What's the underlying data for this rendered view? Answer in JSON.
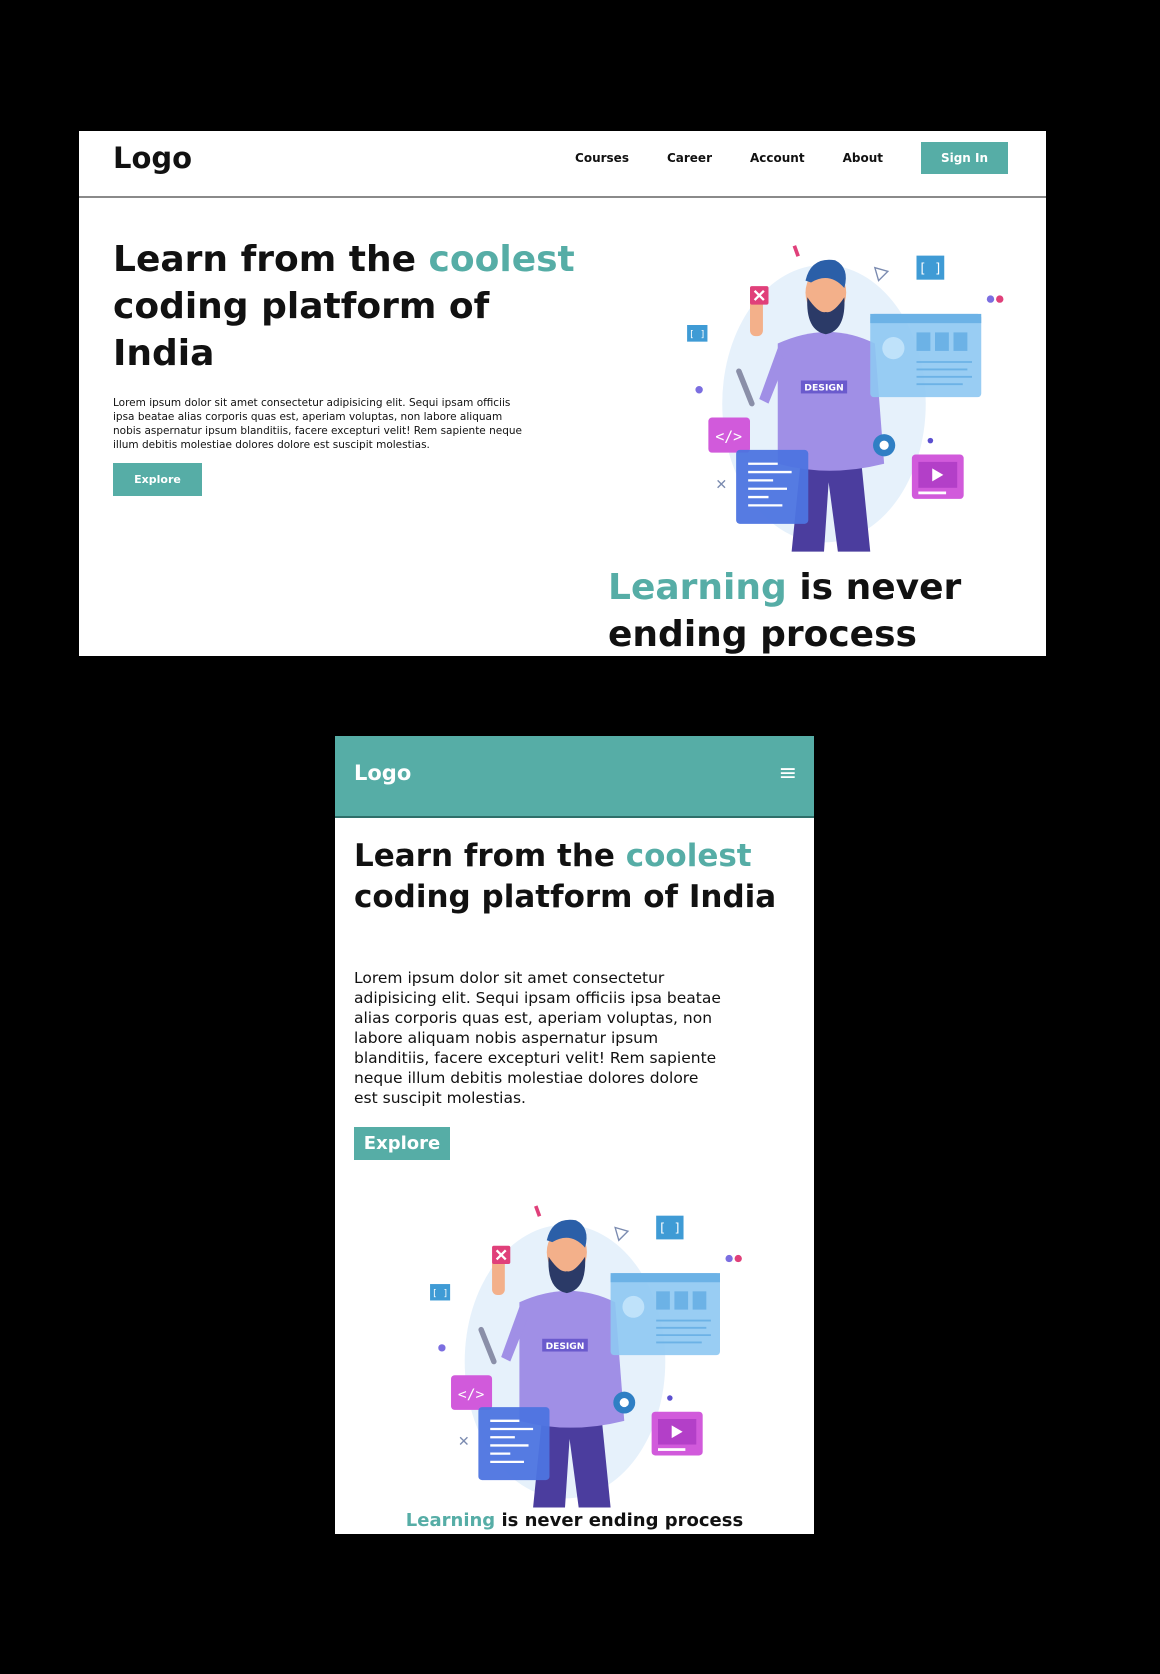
{
  "brand": {
    "teal": "#56ada6",
    "dark": "#111111"
  },
  "desktop": {
    "logo": "Logo",
    "nav": [
      "Courses",
      "Career",
      "Account",
      "About"
    ],
    "signin": "Sign In",
    "headline": {
      "pre": "Learn from the ",
      "accent": "coolest",
      "post": " coding platform of India"
    },
    "paragraph": "Lorem ipsum dolor sit amet consectetur adipisicing elit. Sequi ipsam officiis ipsa beatae alias corporis quas est, aperiam voluptas, non labore aliquam nobis aspernatur ipsum blanditiis, facere excepturi velit! Rem sapiente neque illum debitis molestiae dolores dolore est suscipit molestias.",
    "explore": "Explore",
    "illustration": {
      "badge": "DESIGN",
      "code_tag": "</>",
      "bracket": "[ ]"
    },
    "tagline": {
      "accent": "Learning",
      "rest": " is never ending process"
    }
  },
  "mobile": {
    "logo": "Logo",
    "menu_icon": "≡",
    "headline": {
      "pre": "Learn from the ",
      "accent": "coolest",
      "post": " coding platform of India"
    },
    "paragraph": "Lorem ipsum dolor sit amet consectetur adipisicing elit. Sequi ipsam officiis ipsa beatae alias corporis quas est, aperiam voluptas, non labore aliquam nobis aspernatur ipsum blanditiis, facere excepturi velit! Rem sapiente neque illum debitis molestiae dolores dolore est suscipit molestias.",
    "explore": "Explore",
    "illustration": {
      "badge": "DESIGN",
      "code_tag": "</>",
      "bracket": "[ ]"
    },
    "tagline": {
      "accent": "Learning",
      "rest": " is never ending process"
    }
  }
}
